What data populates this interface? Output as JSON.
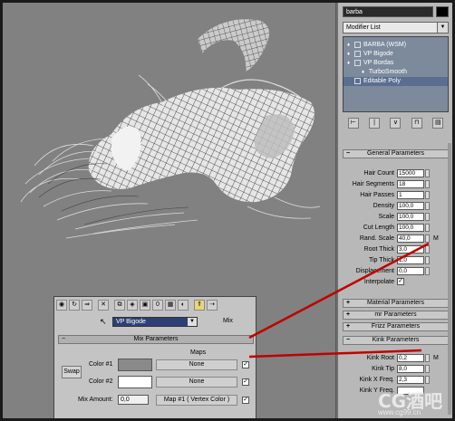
{
  "object_name": "barba",
  "modifier_list_label": "Modifier List",
  "stack": [
    {
      "label": "BARBA (WSM)",
      "selected": false
    },
    {
      "label": "VP Bigode",
      "selected": false
    },
    {
      "label": "VP Bordas",
      "selected": false
    },
    {
      "label": "TurboSmooth",
      "selected": false
    },
    {
      "label": "Editable Poly",
      "selected": true
    }
  ],
  "general": {
    "title": "General Parameters",
    "params": [
      {
        "label": "Hair Count",
        "value": "15000"
      },
      {
        "label": "Hair Segments",
        "value": "18"
      },
      {
        "label": "Hair Passes",
        "value": "1"
      },
      {
        "label": "Density",
        "value": "100,0"
      },
      {
        "label": "Scale",
        "value": "100,0"
      },
      {
        "label": "Cut Length",
        "value": "100,0"
      },
      {
        "label": "Rand. Scale",
        "value": "40,0",
        "map": "M"
      },
      {
        "label": "Root Thick",
        "value": "3,0"
      },
      {
        "label": "Tip Thick",
        "value": "1,0"
      },
      {
        "label": "Displacement",
        "value": "0,0"
      }
    ],
    "interpolate_label": "Interpolate",
    "interpolate_checked": "✓"
  },
  "collapsed_rollouts": [
    "Material Parameters",
    "mr Parameters",
    "Frizz Parameters"
  ],
  "kink": {
    "title": "Kink Parameters",
    "params": [
      {
        "label": "Kink Root",
        "value": "0,2",
        "map": "M"
      },
      {
        "label": "Kink Tip",
        "value": "8,0"
      },
      {
        "label": "Kink X Freq.",
        "value": "2,3"
      },
      {
        "label": "Kink Y Freq.",
        "value": ""
      }
    ]
  },
  "mix_window": {
    "map_name": "VP Bigode",
    "mix_label": "Mix",
    "rollout_title": "Mix Parameters",
    "maps_header": "Maps",
    "swap_label": "Swap",
    "color1_label": "Color #1",
    "color2_label": "Color #2",
    "color1_map": "None",
    "color2_map": "None",
    "color1_hex": "#8a8a8a",
    "color2_hex": "#ffffff",
    "mix_amount_label": "Mix Amount:",
    "mix_amount_value": "0,0",
    "mix_amount_map": "Map #1  ( Vertex Color )",
    "check": "✓"
  },
  "watermark": {
    "logo": "CG酒吧",
    "url": "www.cg99.cn"
  },
  "colors": {
    "viewport_bg": "#818181",
    "panel_bg": "#b8b8b8",
    "stack_bg": "#7c8a9c",
    "highlight_line": "#c00000"
  }
}
